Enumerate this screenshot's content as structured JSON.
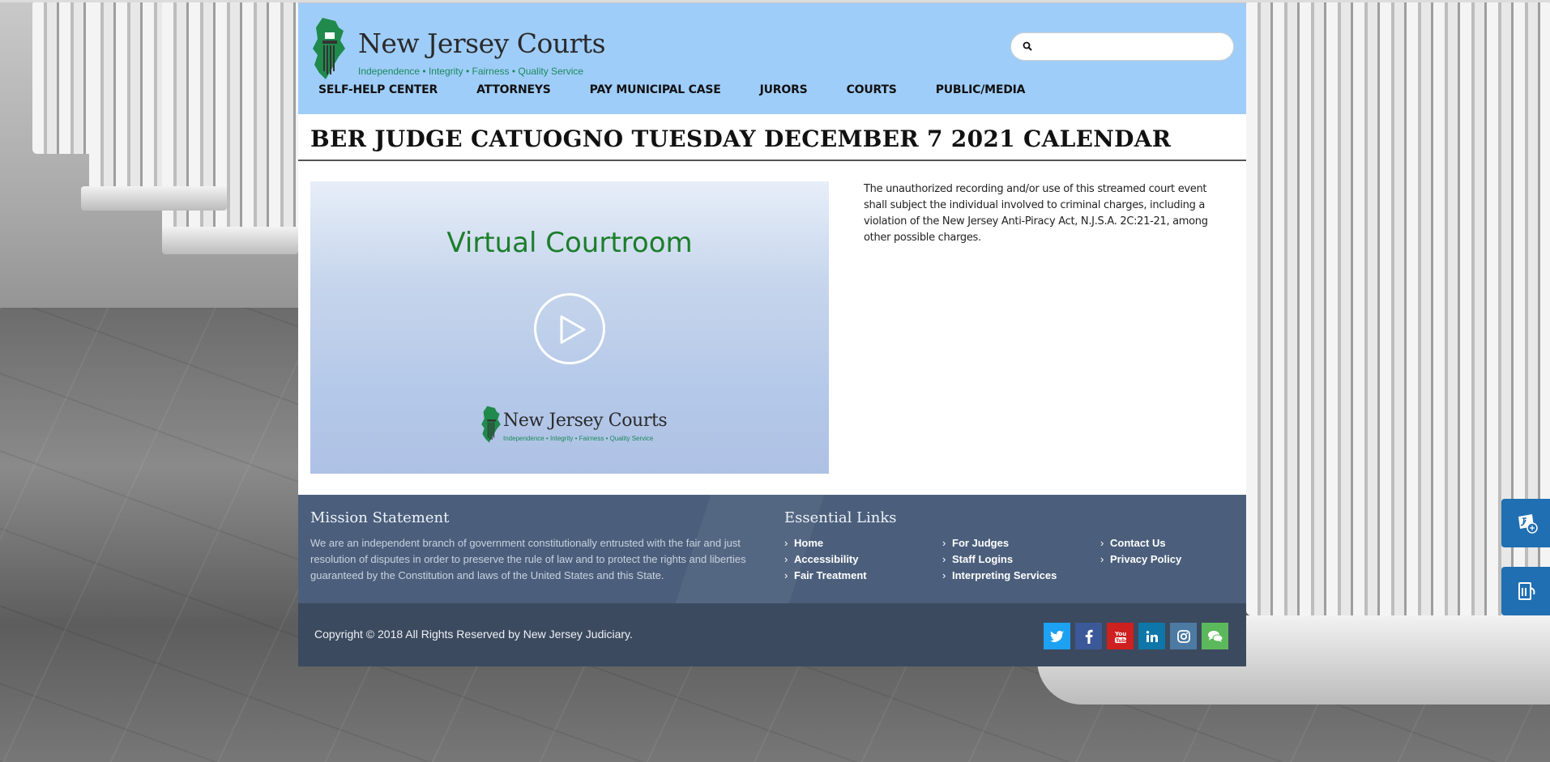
{
  "header": {
    "logo_title": "New Jersey Courts",
    "logo_tagline": "Independence • Integrity • Fairness • Quality Service",
    "search": {
      "placeholder": "",
      "icon": "search-icon"
    },
    "nav": [
      "SELF-HELP CENTER",
      "ATTORNEYS",
      "PAY MUNICIPAL CASE",
      "JURORS",
      "COURTS",
      "PUBLIC/MEDIA"
    ]
  },
  "page": {
    "title": "BER JUDGE CATUOGNO TUESDAY DECEMBER 7 2021 CALENDAR"
  },
  "video": {
    "heading": "Virtual Courtroom",
    "logo_title": "New Jersey Courts",
    "logo_tagline": "Independence • Integrity • Fairness • Quality Service",
    "play_icon": "play-icon"
  },
  "notice": "The unauthorized recording and/or use of this streamed court event shall subject the individual involved to criminal charges, including a violation of the New Jersey Anti-Piracy Act, N.J.S.A. 2C:21-21, among other possible charges.",
  "footer": {
    "mission_heading": "Mission Statement",
    "mission_text": "We are an independent branch of government constitutionally entrusted with the fair and just resolution of disputes in order to preserve the rule of law and to protect the rights and liberties guaranteed by the Constitution and laws of the United States and this State.",
    "links_heading": "Essential Links",
    "links": [
      "Home",
      "For Judges",
      "Contact Us",
      "Accessibility",
      "Staff Logins",
      "Privacy Policy",
      "Fair Treatment",
      "Interpreting Services"
    ],
    "copyright": "Copyright © 2018 All Rights Reserved by New Jersey Judiciary.",
    "social": [
      {
        "name": "twitter",
        "glyph": "t",
        "color": "#1da1f2"
      },
      {
        "name": "facebook",
        "glyph": "f",
        "color": "#3b5998"
      },
      {
        "name": "youtube",
        "glyph": "You",
        "color": "#cd201f"
      },
      {
        "name": "linkedin",
        "glyph": "in",
        "color": "#0e76a8"
      },
      {
        "name": "instagram",
        "glyph": "◎",
        "color": "#4c7aa3"
      },
      {
        "name": "chat",
        "glyph": "💬",
        "color": "#5cb85c"
      }
    ]
  },
  "side_tabs": [
    {
      "name": "language-icon"
    },
    {
      "name": "document-icon"
    }
  ],
  "colors": {
    "header_bg": "#9fcdfa",
    "footer_bg": "#4b5f7c",
    "copybar_bg": "#3c4a5f",
    "video_title": "#1b7e2a",
    "side_tab": "#1f6fb2"
  }
}
